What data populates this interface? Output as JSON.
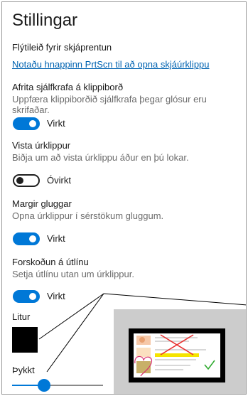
{
  "header": {
    "title": "Stillingar"
  },
  "print_screen": {
    "heading": "Flýtileið fyrir skjáprentun",
    "link": "Notaðu hnappinn PrtScn til að opna skjáúrklippu"
  },
  "auto_copy": {
    "label": "Afrita sjálfkrafa á klippiborð",
    "description": "Uppfæra klippiborðið sjálfkrafa þegar glósur eru skrifaðar.",
    "enabled": true,
    "state_text": "Virkt"
  },
  "save_snips": {
    "label": "Vista úrklippur",
    "description": "Biðja um að vista úrklippu áður en þú lokar.",
    "enabled": false,
    "state_text": "Óvirkt"
  },
  "multiple_windows": {
    "label": "Margir gluggar",
    "description": "Opna úrklippur í sérstökum gluggum.",
    "enabled": true,
    "state_text": "Virkt"
  },
  "outline": {
    "label": "Forskoðun á útlínu",
    "description": "Setja útlínu utan um úrklippur.",
    "enabled": true,
    "state_text": "Virkt",
    "color_label": "Litur",
    "color": "#000000",
    "thickness_label": "Þykkt",
    "thickness_value": 0.35
  },
  "colors": {
    "accent": "#0078d7",
    "link": "#0063b1",
    "text": "#1a1a1a",
    "secondary_text": "#6b6b6b",
    "preview_background": "#cccccc"
  }
}
